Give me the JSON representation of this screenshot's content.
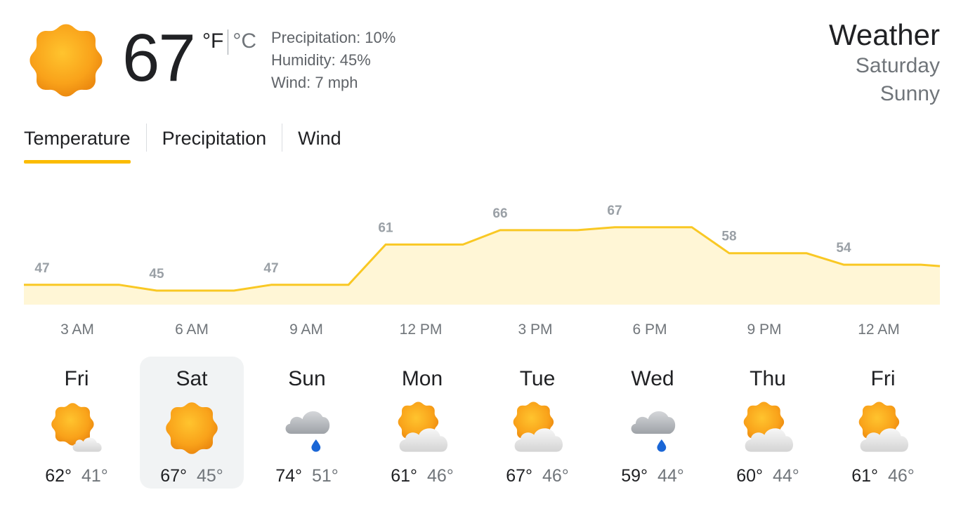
{
  "current": {
    "temp": "67",
    "unit_f": "°F",
    "unit_c": "°C",
    "precipitation": "Precipitation: 10%",
    "humidity": "Humidity: 45%",
    "wind": "Wind: 7 mph",
    "icon": "sun-icon"
  },
  "header": {
    "title": "Weather",
    "day": "Saturday",
    "condition": "Sunny"
  },
  "tabs": [
    {
      "label": "Temperature",
      "active": true
    },
    {
      "label": "Precipitation",
      "active": false
    },
    {
      "label": "Wind",
      "active": false
    }
  ],
  "colors": {
    "accent": "#fbbc04",
    "line": "#f9c824",
    "area": "#fff6d6",
    "label": "#9aa0a6",
    "selected_bg": "#f1f3f4"
  },
  "chart_data": {
    "type": "area",
    "x": [
      "3 AM",
      "6 AM",
      "9 AM",
      "12 PM",
      "3 PM",
      "6 PM",
      "9 PM",
      "12 AM"
    ],
    "values": [
      47,
      45,
      47,
      61,
      66,
      67,
      58,
      54
    ],
    "title": "",
    "xlabel": "",
    "ylabel": ""
  },
  "forecast": [
    {
      "day": "Fri",
      "icon": "partly-cloudy-icon",
      "hi": "62°",
      "lo": "41°"
    },
    {
      "day": "Sat",
      "icon": "sun-icon",
      "hi": "67°",
      "lo": "45°"
    },
    {
      "day": "Sun",
      "icon": "rain-cloud-icon",
      "hi": "74°",
      "lo": "51°"
    },
    {
      "day": "Mon",
      "icon": "mostly-cloudy-icon",
      "hi": "61°",
      "lo": "46°"
    },
    {
      "day": "Tue",
      "icon": "mostly-cloudy-icon",
      "hi": "67°",
      "lo": "46°"
    },
    {
      "day": "Wed",
      "icon": "rain-cloud-icon",
      "hi": "59°",
      "lo": "44°"
    },
    {
      "day": "Thu",
      "icon": "mostly-cloudy-icon",
      "hi": "60°",
      "lo": "44°"
    },
    {
      "day": "Fri",
      "icon": "mostly-cloudy-icon",
      "hi": "61°",
      "lo": "46°"
    }
  ]
}
